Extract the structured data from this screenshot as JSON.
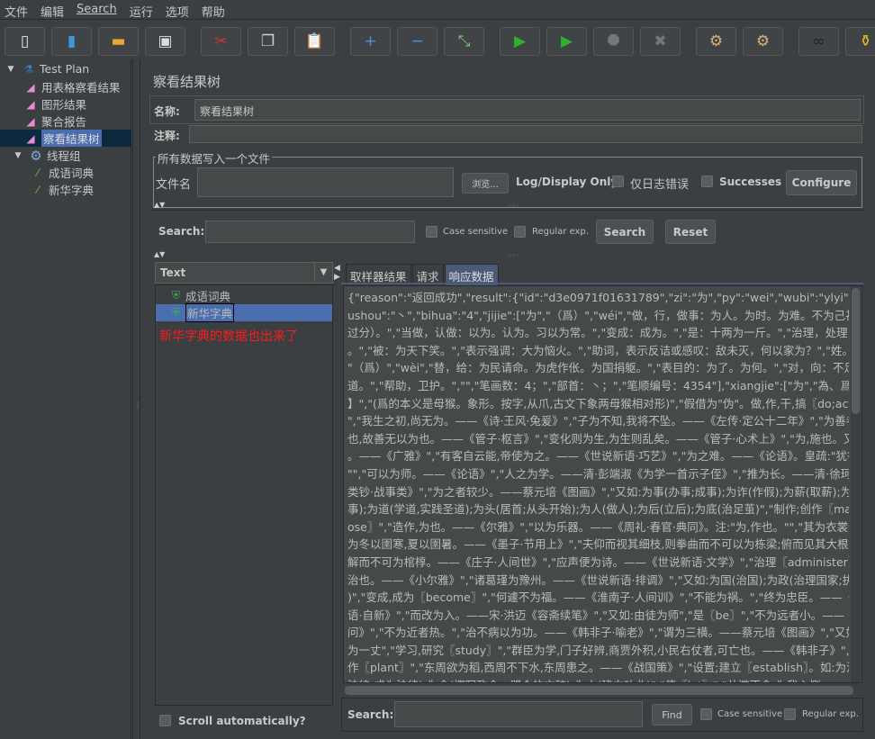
{
  "menu": [
    "文件",
    "编辑",
    "Search",
    "运行",
    "选项",
    "帮助"
  ],
  "toolbar": [
    {
      "icon": "new-icon",
      "glyph": "▯",
      "color": "#e6e6e6"
    },
    {
      "icon": "templates-icon",
      "glyph": "▮",
      "color": "#3a9ad9"
    },
    {
      "icon": "open-icon",
      "glyph": "▬",
      "color": "#e8a632"
    },
    {
      "icon": "save-icon",
      "glyph": "▣",
      "color": "#dcdcdc"
    },
    {
      "icon": "cut-icon",
      "glyph": "✂",
      "color": "#d63030"
    },
    {
      "icon": "copy-icon",
      "glyph": "❐",
      "color": "#d0d0d0"
    },
    {
      "icon": "paste-icon",
      "glyph": "📋",
      "color": "#c0874a"
    },
    {
      "icon": "expand-icon",
      "glyph": "+",
      "color": "#4a90e2"
    },
    {
      "icon": "collapse-icon",
      "glyph": "−",
      "color": "#4a90e2"
    },
    {
      "icon": "toggle-icon",
      "glyph": "⤡",
      "color": "#7ec87e"
    },
    {
      "icon": "start-icon",
      "glyph": "▶",
      "color": "#2fb12f"
    },
    {
      "icon": "start-no-pause-icon",
      "glyph": "▶",
      "color": "#2fb12f"
    },
    {
      "icon": "stop-icon",
      "glyph": "⯃",
      "color": "#777"
    },
    {
      "icon": "shutdown-icon",
      "glyph": "✖",
      "color": "#777"
    },
    {
      "icon": "clear-icon",
      "glyph": "⚙",
      "color": "#d8b27a"
    },
    {
      "icon": "clear-all-icon",
      "glyph": "⚙",
      "color": "#d8b27a"
    },
    {
      "icon": "search-binoculars-icon",
      "glyph": "∞",
      "color": "#222"
    },
    {
      "icon": "reset-search-broom-icon",
      "glyph": "⚱",
      "color": "#e8c020"
    }
  ],
  "tree": {
    "root": "Test Plan",
    "listeners": [
      "用表格察看结果",
      "图形结果",
      "聚合报告",
      "察看结果树"
    ],
    "thread_group": "线程组",
    "samplers": [
      "成语词典",
      "新华字典"
    ]
  },
  "panel": {
    "title": "察看结果树",
    "name_label": "名称:",
    "name_value": "察看结果树",
    "comment_label": "注释:",
    "comment_value": "",
    "file_group": "所有数据写入一个文件",
    "filename_label": "文件名",
    "filename_value": "",
    "browse": "浏览...",
    "log_display": "Log/Display Only:",
    "errors_only": "仅日志错误",
    "successes": "Successes",
    "configure": "Configure"
  },
  "search": {
    "label": "Search:",
    "value": "",
    "case_sensitive": "Case sensitive",
    "regex": "Regular exp.",
    "search_btn": "Search",
    "reset_btn": "Reset"
  },
  "results": {
    "renderer": "Text",
    "items": [
      "成语词典",
      "新华字典"
    ],
    "selected": "新华字典",
    "annotation": "新华字典的数据也出来了",
    "annotation_color": "#ff1a1a",
    "scroll_auto": "Scroll automatically?"
  },
  "tabs": [
    "取样器结果",
    "请求",
    "响应数据"
  ],
  "active_tab": "响应数据",
  "response_lines": [
    "{\"reason\":\"返回成功\",\"result\":{\"id\":\"d3e0971f01631789\",\"zi\":\"为\",\"py\":\"wei\",\"wubi\":\"ylyi\",\"pinyin\":\"wéi,wèi\",\"b",
    "ushou\":\"丶\",\"bihua\":\"4\",\"jijie\":[\"为\",\"（爲）\",\"wéi\",\"做，行，做事：为人。为时。为难。不为己甚（不做得太",
    "过分）。\",\"当做，认做：以为。认为。习以为常。\",\"变成：成为。\",\"是：十两为一斤。\",\"治理，处理：为政",
    "。\",\"被：为天下笑。\",\"表示强调：大为恼火。\",\"助词，表示反诘或感叹：敌未灭，何以家为？\",\"姓。\",\"\",\"为",
    "\"（爲）\",\"wèi\",\"替，给：为民请命。为虎作伥。为国捐躯。\",\"表目的：为了。为何。\",\"对，向：不足为外人",
    "道。\",\"帮助，卫护。\",\"\",\"笔画数：4；\",\"部首：丶；\",\"笔顺编号：4354\"],\"xiangjie\":[\"为\",\"為、爲\",\"wéi\",\"【动",
    "】\",\"(爲的本义是母猴。象形。按字,从爪,古文下象两母猴相对形)\",\"假借为\"伪\"。做,作,干,搞〖do;act;make〗",
    "\",\"我生之初,尚无为。——《诗·王风·兔爰》\",\"子为不知,我将不坠。——《左传·定公十二年》\",\"为善者,非善",
    "也,故善无以为也。——《管子·枢言》\",\"变化则为生,为生则乱矣。——《管子·心术上》\",\"为,施也。又,成也",
    "。——《广雅》\",\"有客自云能,帝使为之。——《世说新语·巧艺》\",\"为之难。——《论语》。皇疏:\"犹行也。",
    "\"\",\"可以为师。——《论语》\",\"人之为学。——清·彭端淑《为学一首示子侄》\",\"推为长。——清·徐珂《清稗",
    "类钞·战事类》\",\"为之者较少。——蔡元培《图画》\",\"又如:为事(办事;成事);为诈(作假);为薪(取薪);为善(做善",
    "事);为道(学道,实践圣道);为头(居首;从头开始);为人(做人);为后(立后);为底(治足茧)\",\"制作;创作〖make;com",
    "ose〗\",\"造作,为也。——《尔雅》\",\"以为乐器。——《周礼·春官·典同》。注:\"为,作也。\"\",\"其为衣裳何?以",
    "为冬以圉寒,夏以圉暑。——《墨子·节用上》\",\"夫仰而视其细枝,则拳曲而不可以为栋梁;俯而见其大根,则轴",
    "解而不可为棺椁。——《庄子·人间世》\",\"应声便为诗。——《世说新语·文学》\",\"治理〖administer〗\",\"为",
    "治也。——《小尔雅》\",\"诸葛瑾为豫州。——《世说新语·排调》\",\"又如:为国(治国);为政(治理国家;执掌国政",
    ")\",\"变成,成为〖become〗\",\"何遽不为福。——《淮南子·人间训》\",\"不能为祸。\",\"终为忠臣。——《世说新",
    "语·自新》\",\"而改为入。——宋·洪迈《容斋续笔》\",\"又如:由徒为师\",\"是〖be〗\",\"不为远者小。——《列子·汤",
    "问》\",\"不为近者热。\",\"治不病以为功。——《韩非子·喻老》\",\"谓为三横。——蔡元培《图画》\",\"又如:十尺",
    "为一丈\",\"学习,研究〖study〗\",\"群臣为学,门子好辨,商贾外积,小民右仗者,可亡也。——《韩非子》\",\"种植;莳",
    "作〖plant〗\",\"东周欲为稻,西周不下水,东周患之。——《战国策》\",\"设置;建立〖establish〗。如:为法(制定",
    "法律;成为法律);为命(撰写政令、盟会的文辞);为山(建立功业)\",\"使〖let〗\",\"井渫不食,为我心恻。——《易·井",
    "》\",\"以为;认为〖think;bilieve;consider〗\",\"为汝多智。——《列子·汤问》\",\"惊为生人。——清·薛福成《观"
  ],
  "find": {
    "label": "Search:",
    "value": "",
    "find_btn": "Find",
    "case_sensitive": "Case sensitive",
    "regex": "Regular exp."
  }
}
